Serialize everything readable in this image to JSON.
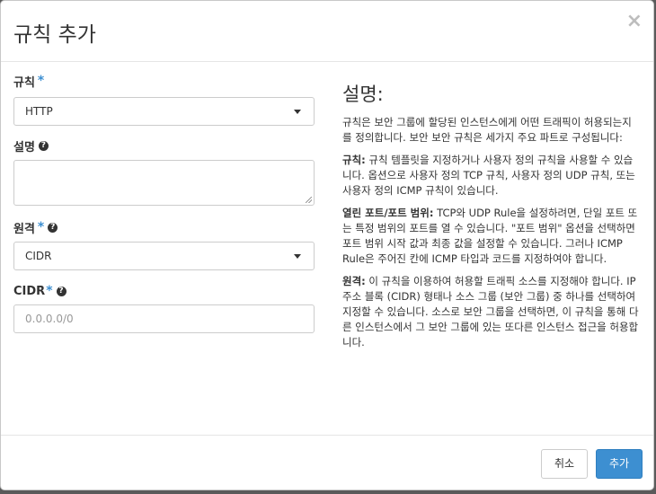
{
  "dialog": {
    "title": "규칙 추가",
    "close": "×"
  },
  "form": {
    "rule": {
      "label": "규칙",
      "required_mark": "*",
      "value": "HTTP"
    },
    "description": {
      "label": "설명",
      "help": "?",
      "value": ""
    },
    "remote": {
      "label": "원격",
      "required_mark": "*",
      "help": "?",
      "value": "CIDR"
    },
    "cidr": {
      "label": "CIDR",
      "required_mark": "*",
      "help": "?",
      "placeholder": "0.0.0.0/0"
    }
  },
  "help_panel": {
    "title": "설명:",
    "intro": "규칙은 보안 그룹에 할당된 인스턴스에게 어떤 트래픽이 허용되는지를 정의합니다. 보안 보안 규칙은 세가지 주요 파트로 구성됩니다:",
    "rule_term": "규칙:",
    "rule_text": "규칙 템플릿을 지정하거나 사용자 정의 규칙을 사용할 수 있습니다. 옵션으로 사용자 정의 TCP 규칙, 사용자 정의 UDP 규칙, 또는 사용자 정의 ICMP 규칙이 있습니다.",
    "port_term": "열린 포트/포트 범위:",
    "port_text": "TCP와 UDP Rule을 설정하려면, 단일 포트 또는 특정 범위의 포트를 열 수 있습니다. \"포트 범위\" 옵션을 선택하면 포트 범위 시작 값과 최종 값을 설정할 수 있습니다. 그러나 ICMP Rule은 주어진 칸에 ICMP 타입과 코드를 지정하여야 합니다.",
    "remote_term": "원격:",
    "remote_text": "이 규칙을 이용하여 허용할 트래픽 소스를 지정해야 합니다. IP 주소 블록 (CIDR) 형태나 소스 그룹 (보안 그룹) 중 하나를 선택하여 지정할 수 있습니다. 소스로 보안 그룹을 선택하면, 이 규칙을 통해 다른 인스턴스에서 그 보안 그룹에 있는 또다른 인스턴스 접근을 허용합니다."
  },
  "footer": {
    "cancel_label": "취소",
    "add_label": "추가"
  },
  "colors": {
    "accent": "#3d8fd1",
    "required": "#3d8fd1"
  }
}
